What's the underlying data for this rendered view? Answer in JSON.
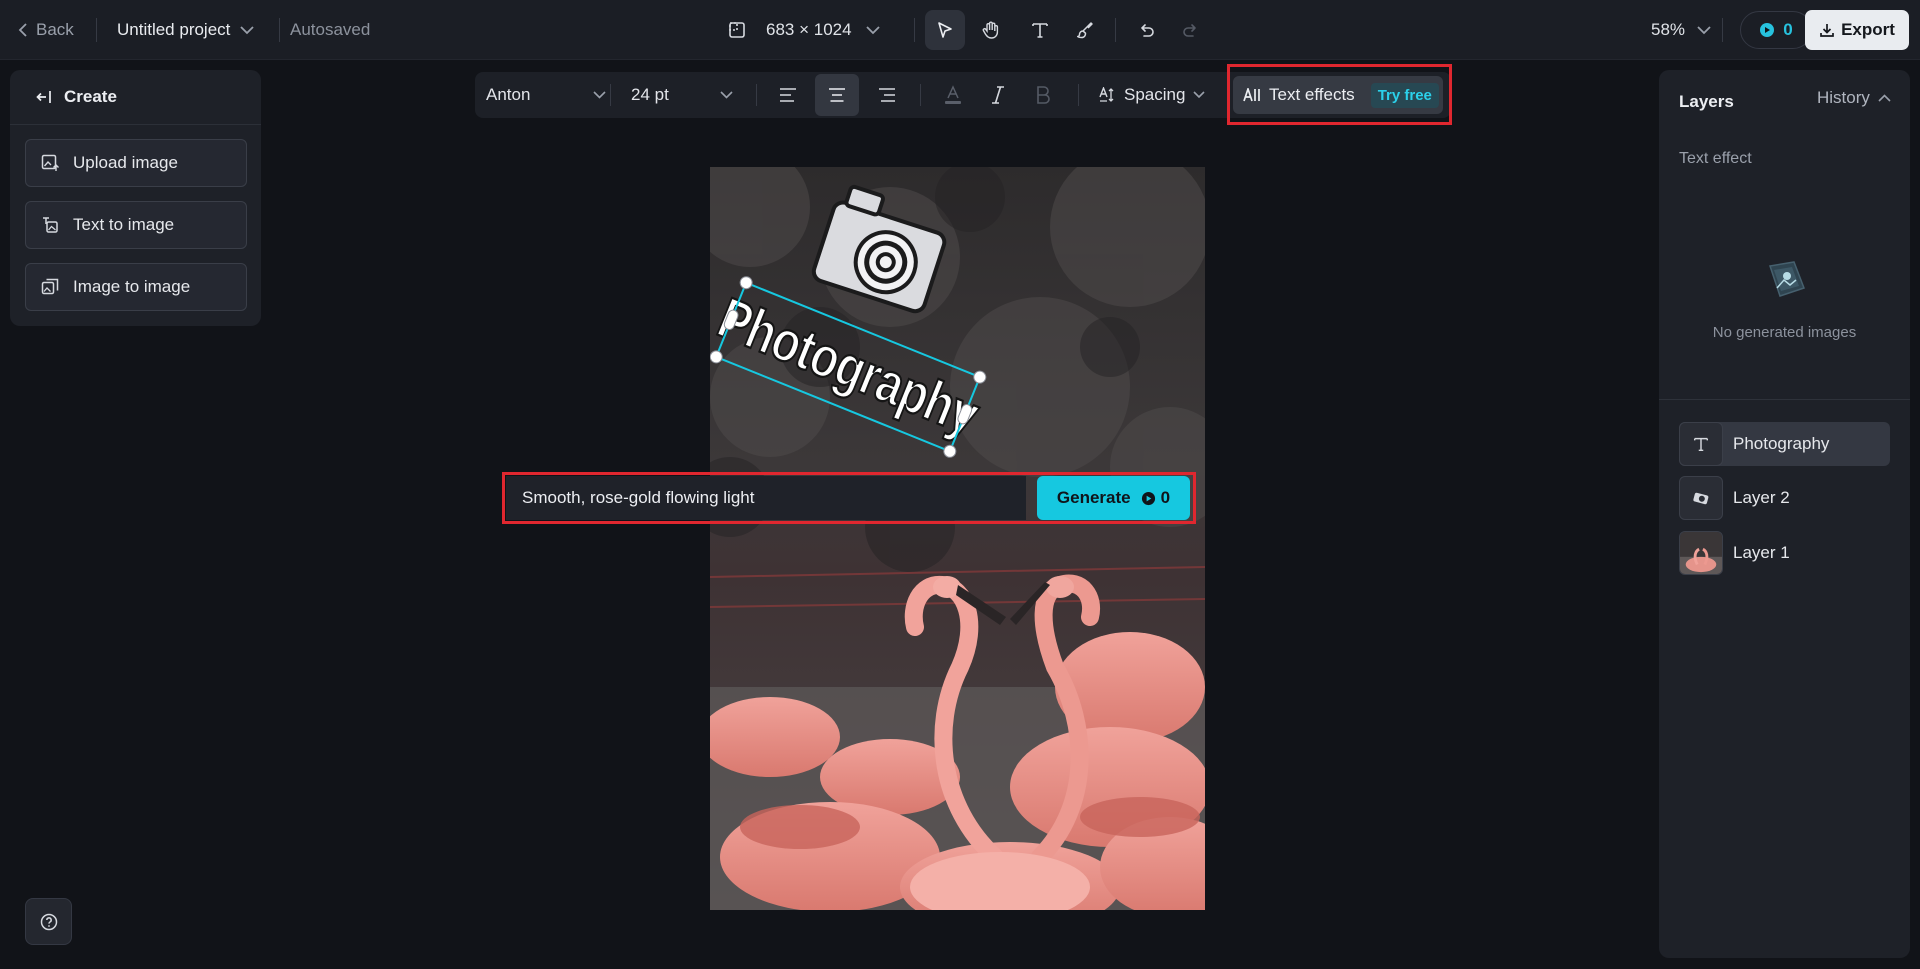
{
  "topbar": {
    "back_label": "Back",
    "project_name": "Untitled project",
    "autosave_status": "Autosaved",
    "canvas_size": "683 × 1024",
    "zoom": "58%",
    "credits": "0",
    "export_label": "Export"
  },
  "left_panel": {
    "title": "Create",
    "items": [
      {
        "label": "Upload image",
        "icon": "upload-image-icon"
      },
      {
        "label": "Text to image",
        "icon": "text-to-image-icon"
      },
      {
        "label": "Image to image",
        "icon": "image-to-image-icon"
      }
    ]
  },
  "text_toolbar": {
    "font": "Anton",
    "font_size": "24 pt",
    "alignment": "center",
    "spacing_label": "Spacing",
    "effects_label": "Text effects",
    "try_free": "Try free"
  },
  "canvas": {
    "text_layer": "Photography"
  },
  "prompt": {
    "value": "Smooth, rose-gold flowing light",
    "generate_label": "Generate",
    "generate_cost": "0"
  },
  "right_panel": {
    "layers_title": "Layers",
    "history_label": "History",
    "section_title": "Text effect",
    "empty_message": "No generated images",
    "layers": [
      {
        "name": "Photography",
        "type": "text",
        "selected": true
      },
      {
        "name": "Layer 2",
        "type": "image",
        "selected": false
      },
      {
        "name": "Layer 1",
        "type": "image",
        "selected": false
      }
    ]
  },
  "colors": {
    "accent": "#16c8e0",
    "highlight": "#e0272f",
    "background": "#111318"
  }
}
